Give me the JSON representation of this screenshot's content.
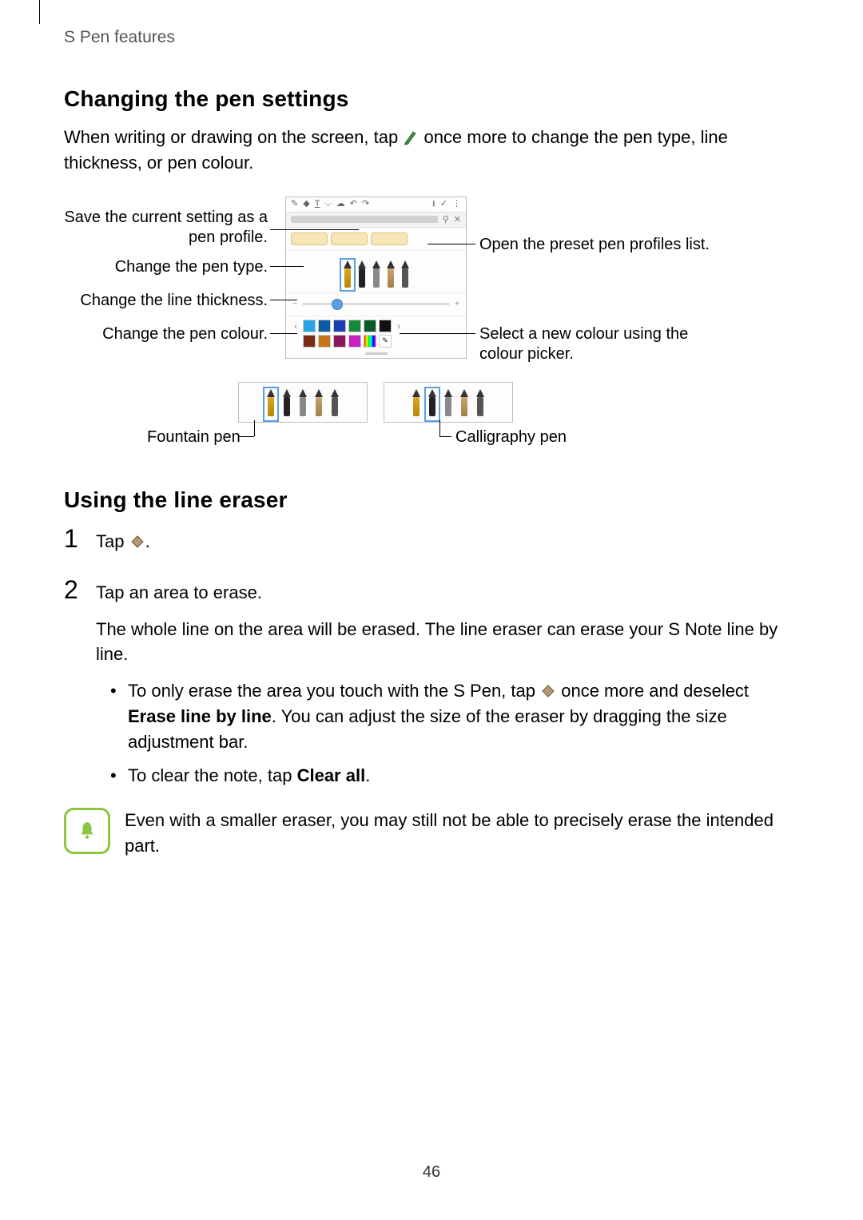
{
  "page": {
    "running_header": "S Pen features",
    "number": "46"
  },
  "section_changing": {
    "title": "Changing the pen settings",
    "para_before_icon": "When writing or drawing on the screen, tap ",
    "para_after_icon": " once more to change the pen type, line thickness, or pen colour."
  },
  "callouts": {
    "save_profile": "Save the current setting as a pen profile.",
    "change_type": "Change the pen type.",
    "change_thickness": "Change the line thickness.",
    "change_colour": "Change the pen colour.",
    "open_presets": "Open the preset pen profiles list.",
    "colour_picker": "Select a new colour using the colour picker.",
    "fountain_pen": "Fountain pen",
    "calligraphy_pen": "Calligraphy pen"
  },
  "section_eraser": {
    "title": "Using the line eraser",
    "step1_prefix": "Tap ",
    "step1_suffix": ".",
    "step2_line1": "Tap an area to erase.",
    "step2_line2": "The whole line on the area will be erased. The line eraser can erase your S Note line by line.",
    "bullet1_prefix": "To only erase the area you touch with the S Pen, tap ",
    "bullet1_mid": " once more and deselect ",
    "bullet1_bold": "Erase line by line",
    "bullet1_suffix": ". You can adjust the size of the eraser by dragging the size adjustment bar.",
    "bullet2_prefix": "To clear the note, tap ",
    "bullet2_bold": "Clear all",
    "bullet2_suffix": ".",
    "note": "Even with a smaller eraser, you may still not be able to precisely erase the intended part."
  },
  "icons": {
    "pen": "pen-icon",
    "eraser": "eraser-icon",
    "bell": "bell-icon"
  },
  "swatches_row1": [
    "#2aa3e8",
    "#0b5aa6",
    "#1a3fae",
    "#168a3a",
    "#0a5a2a",
    "#111111"
  ],
  "swatches_row2": [
    "#7a2a12",
    "#c9741a",
    "#8a1560",
    "#c920c0",
    "#6fe210",
    "#ffffff"
  ]
}
